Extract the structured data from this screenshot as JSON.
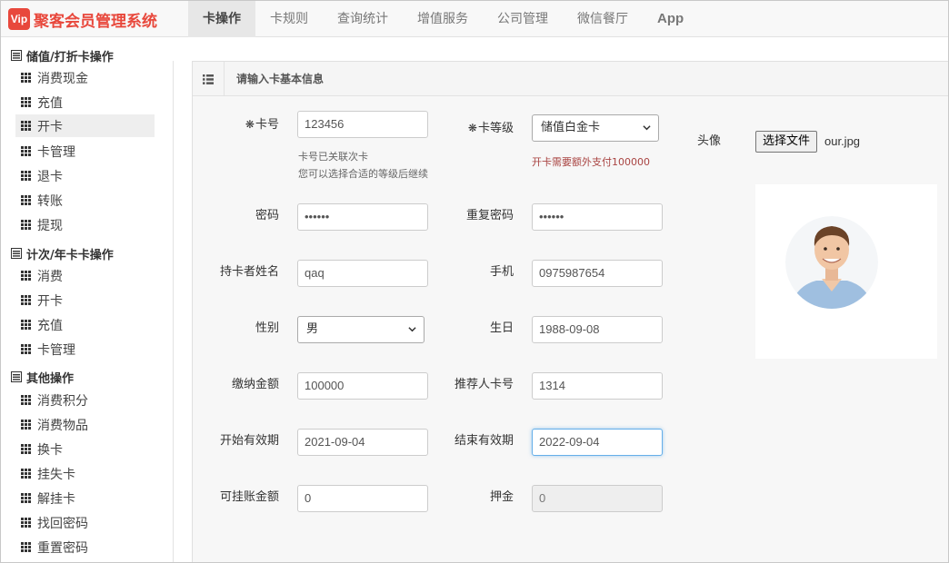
{
  "app": {
    "logo_badge": "Vip",
    "title": "聚客会员管理系统"
  },
  "nav": {
    "items": [
      {
        "label": "卡操作",
        "active": true
      },
      {
        "label": "卡规则"
      },
      {
        "label": "查询统计"
      },
      {
        "label": "增值服务"
      },
      {
        "label": "公司管理"
      },
      {
        "label": "微信餐厅"
      },
      {
        "label": "App"
      }
    ]
  },
  "sidebar": {
    "groups": [
      {
        "title": "储值/打折卡操作",
        "items": [
          "消费现金",
          "充值",
          "开卡",
          "卡管理",
          "退卡",
          "转账",
          "提现"
        ]
      },
      {
        "title": "计次/年卡卡操作",
        "items": [
          "消费",
          "开卡",
          "充值",
          "卡管理"
        ]
      },
      {
        "title": "其他操作",
        "items": [
          "消费积分",
          "消费物品",
          "换卡",
          "挂失卡",
          "解挂卡",
          "找回密码",
          "重置密码"
        ]
      }
    ],
    "active_item": "储值/打折卡操作 > 开卡"
  },
  "panel": {
    "title": "请输入卡基本信息",
    "icon": "list-icon"
  },
  "form": {
    "required_mark": "❋",
    "card_no": {
      "label": "卡号",
      "value": "123456"
    },
    "card_hint_1": "卡号已关联次卡",
    "card_hint_2": "您可以选择合适的等级后继续",
    "card_level": {
      "label": "卡等级",
      "value": "储值白金卡"
    },
    "card_level_warn": "开卡需要额外支付100000",
    "password": {
      "label": "密码",
      "value": "••••••"
    },
    "repeat_password": {
      "label": "重复密码",
      "value": "••••••"
    },
    "holder_name": {
      "label": "持卡者姓名",
      "value": "qaq"
    },
    "phone": {
      "label": "手机",
      "value": "0975987654"
    },
    "gender": {
      "label": "性别",
      "value": "男"
    },
    "birthday": {
      "label": "生日",
      "value": "1988-09-08"
    },
    "payment": {
      "label": "缴纳金额",
      "value": "100000"
    },
    "referrer": {
      "label": "推荐人卡号",
      "value": "1314"
    },
    "start_date": {
      "label": "开始有效期",
      "value": "2021-09-04"
    },
    "end_date": {
      "label": "结束有效期",
      "value": "2022-09-04"
    },
    "credit": {
      "label": "可挂账金额",
      "value": "0"
    },
    "deposit": {
      "label": "押金",
      "value": "0"
    },
    "avatar": {
      "label": "头像",
      "button": "选择文件",
      "file_name": "our.jpg"
    }
  },
  "colors": {
    "brand": "#e8483c",
    "warning": "#a94442",
    "focus": "#66afe9"
  }
}
